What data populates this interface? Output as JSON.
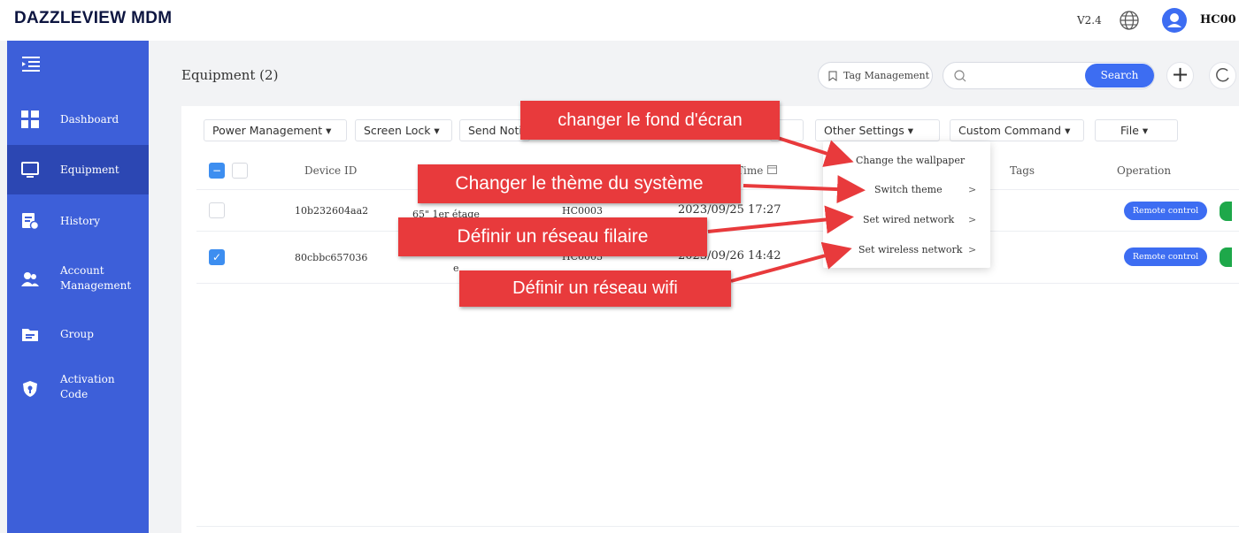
{
  "header": {
    "brand": "DAZZLEVIEW MDM",
    "version": "V2.4",
    "user": "HC00",
    "language_icon": "globe-icon",
    "avatar_icon": "user-avatar-icon"
  },
  "sidebar": {
    "toggle_icon": "menu-collapse-icon",
    "items": [
      {
        "label": "Dashboard",
        "icon": "dashboard-icon",
        "active": false
      },
      {
        "label": "Equipment",
        "icon": "monitor-icon",
        "active": true
      },
      {
        "label": "History",
        "icon": "history-icon",
        "active": false
      },
      {
        "label_line1": "Account",
        "label_line2": "Management",
        "icon": "account-icon",
        "active": false
      },
      {
        "label": "Group",
        "icon": "folder-icon",
        "active": false
      },
      {
        "label_line1": "Activation",
        "label_line2": "Code",
        "icon": "shield-icon",
        "active": false
      }
    ]
  },
  "main": {
    "title": "Equipment (2)",
    "tag_management": "Tag Management",
    "search_placeholder": "",
    "search_label": "Search",
    "plus_label": "+"
  },
  "toolbar": {
    "power": "Power Management ▾",
    "screen_lock": "Screen Lock ▾",
    "send_notice": "Send Notice",
    "other_settings": "Other Settings ▾",
    "custom_command": "Custom Command ▾",
    "file": "File ▾"
  },
  "table": {
    "headers": {
      "device_id": "Device ID",
      "time": "Time",
      "tags": "Tags",
      "operation": "Operation"
    },
    "rows": [
      {
        "device_id": "10b232604aa2",
        "name": "65\" 1er étage",
        "user": "HC0003",
        "time": "2023/09/25 17:27",
        "checked": false,
        "action": "Remote control"
      },
      {
        "device_id": "80cbbc657036",
        "name": "e",
        "user": "HC0003",
        "time": "2023/09/26 14:42",
        "checked": true,
        "action": "Remote control"
      }
    ]
  },
  "dropdown": {
    "items": [
      {
        "label": "Change the wallpaper",
        "has_submenu": false
      },
      {
        "label": "Switch theme",
        "has_submenu": true
      },
      {
        "label": "Set wired network",
        "has_submenu": true
      },
      {
        "label": "Set wireless network",
        "has_submenu": true
      }
    ],
    "submenu_arrow": ">"
  },
  "callouts": {
    "wallpaper": "changer le fond d'écran",
    "theme": "Changer le thème du système",
    "wired": "Définir un réseau filaire",
    "wifi": "Définir un réseau wifi",
    "color": "#e83a3c"
  },
  "colors": {
    "sidebar": "#3d5fd9",
    "sidebar_active": "#2c47b3",
    "accent": "#3d6df2",
    "online": "#1ea84a"
  }
}
